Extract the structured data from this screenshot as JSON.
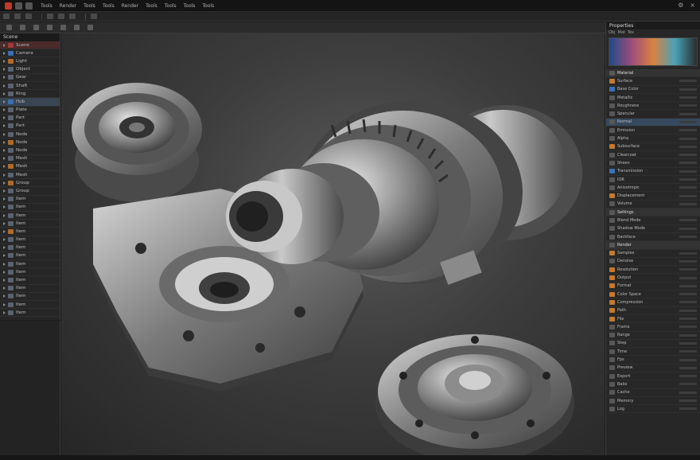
{
  "menubar": {
    "items": [
      "Tools",
      "Render",
      "Tools",
      "Tools",
      "Render",
      "Tools",
      "Tools",
      "Tools",
      "Tools"
    ]
  },
  "left_panel": {
    "title": "Scene",
    "rows": [
      {
        "label": "Scene",
        "icon": "cube-icon",
        "color": "red"
      },
      {
        "label": "Camera",
        "icon": "camera-icon",
        "color": "blue"
      },
      {
        "label": "Light",
        "icon": "light-icon",
        "color": "orange"
      },
      {
        "label": "Object",
        "icon": "object-icon"
      },
      {
        "label": "Gear",
        "icon": "object-icon"
      },
      {
        "label": "Shaft",
        "icon": "object-icon"
      },
      {
        "label": "Ring",
        "icon": "object-icon"
      },
      {
        "label": "Hub",
        "icon": "object-icon",
        "color": "blue"
      },
      {
        "label": "Plate",
        "icon": "object-icon"
      },
      {
        "label": "Part",
        "icon": "object-icon"
      },
      {
        "label": "Part",
        "icon": "object-icon"
      },
      {
        "label": "Node",
        "icon": "object-icon"
      },
      {
        "label": "Node",
        "icon": "object-icon",
        "color": "orange"
      },
      {
        "label": "Node",
        "icon": "object-icon"
      },
      {
        "label": "Mesh",
        "icon": "object-icon"
      },
      {
        "label": "Mesh",
        "icon": "object-icon",
        "color": "orange"
      },
      {
        "label": "Mesh",
        "icon": "object-icon"
      },
      {
        "label": "Group",
        "icon": "object-icon",
        "color": "orange"
      },
      {
        "label": "Group",
        "icon": "object-icon"
      },
      {
        "label": "Item",
        "icon": "object-icon"
      },
      {
        "label": "Item",
        "icon": "object-icon"
      },
      {
        "label": "Item",
        "icon": "object-icon"
      },
      {
        "label": "Item",
        "icon": "object-icon"
      },
      {
        "label": "Item",
        "icon": "object-icon",
        "color": "orange"
      },
      {
        "label": "Item",
        "icon": "object-icon"
      },
      {
        "label": "Item",
        "icon": "object-icon"
      },
      {
        "label": "Item",
        "icon": "object-icon"
      },
      {
        "label": "Item",
        "icon": "object-icon"
      },
      {
        "label": "Item",
        "icon": "object-icon"
      },
      {
        "label": "Item",
        "icon": "object-icon"
      },
      {
        "label": "Item",
        "icon": "object-icon"
      },
      {
        "label": "Item",
        "icon": "object-icon"
      },
      {
        "label": "Item",
        "icon": "object-icon"
      },
      {
        "label": "Item",
        "icon": "object-icon"
      }
    ]
  },
  "right_panel": {
    "title": "Properties",
    "tabs": [
      "Obj",
      "Mat",
      "Tex"
    ],
    "rows": [
      {
        "label": "Material",
        "section": true
      },
      {
        "label": "Surface",
        "icon": "orange"
      },
      {
        "label": "Base Color",
        "icon": "blue"
      },
      {
        "label": "Metallic"
      },
      {
        "label": "Roughness"
      },
      {
        "label": "Specular"
      },
      {
        "label": "Normal",
        "active": true
      },
      {
        "label": "Emission"
      },
      {
        "label": "Alpha"
      },
      {
        "label": "Subsurface",
        "icon": "orange"
      },
      {
        "label": "Clearcoat"
      },
      {
        "label": "Sheen"
      },
      {
        "label": "Transmission",
        "icon": "blue"
      },
      {
        "label": "IOR"
      },
      {
        "label": "Anisotropic"
      },
      {
        "label": "Displacement",
        "icon": "orange"
      },
      {
        "label": "Volume"
      },
      {
        "label": "Settings",
        "section": true
      },
      {
        "label": "Blend Mode"
      },
      {
        "label": "Shadow Mode"
      },
      {
        "label": "Backface"
      },
      {
        "label": "Render",
        "section": true
      },
      {
        "label": "Samples",
        "icon": "orange"
      },
      {
        "label": "Denoise"
      },
      {
        "label": "Resolution",
        "icon": "orange"
      },
      {
        "label": "Output",
        "icon": "orange"
      },
      {
        "label": "Format",
        "icon": "orange"
      },
      {
        "label": "Color Space",
        "icon": "orange"
      },
      {
        "label": "Compression",
        "icon": "orange"
      },
      {
        "label": "Path",
        "icon": "orange"
      },
      {
        "label": "File",
        "icon": "orange"
      },
      {
        "label": "Frame"
      },
      {
        "label": "Range"
      },
      {
        "label": "Step"
      },
      {
        "label": "Time"
      },
      {
        "label": "Fps"
      },
      {
        "label": "Preview"
      },
      {
        "label": "Export"
      },
      {
        "label": "Bake"
      },
      {
        "label": "Cache"
      },
      {
        "label": "Memory"
      },
      {
        "label": "Log"
      }
    ]
  },
  "colors": {
    "accent": "#3a70b8",
    "warning": "#c17a2e"
  }
}
